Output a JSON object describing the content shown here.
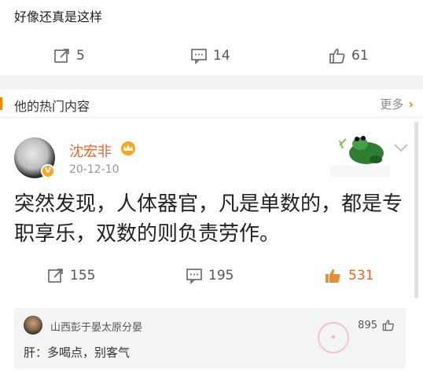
{
  "prev_post": {
    "text": "好像还真是这样",
    "actions": {
      "reposts": "5",
      "comments": "14",
      "likes": "61"
    }
  },
  "section": {
    "title": "他的热门内容",
    "more_label": "更多"
  },
  "post": {
    "author": "沈宏非",
    "date": "20-12-10",
    "body": "突然发现，人体器官，凡是单数的，都是专职享乐，双数的则负责劳作。",
    "actions": {
      "reposts": "155",
      "comments": "195",
      "likes": "531"
    }
  },
  "top_comment": {
    "user": "山西彭于晏太原分晏",
    "likes": "895",
    "text": "肝：多喝点，别客气"
  },
  "colors": {
    "accent": "#ff8200",
    "author_name": "#e8662d",
    "liked": "#f08c2b"
  }
}
